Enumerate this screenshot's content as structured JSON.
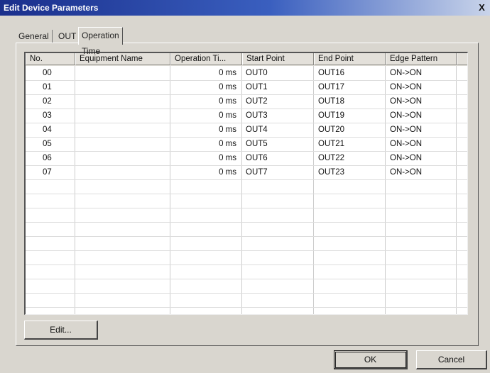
{
  "window": {
    "title": "Edit Device Parameters",
    "close_label": "X"
  },
  "tabs": [
    {
      "label": "General"
    },
    {
      "label": "OUT"
    },
    {
      "label": "Operation Time"
    }
  ],
  "table": {
    "columns": [
      "No.",
      "Equipment Name",
      "Operation Ti...",
      "Start Point",
      "End Point",
      "Edge Pattern"
    ],
    "rows": [
      [
        "00",
        "",
        "0 ms",
        "OUT0",
        "OUT16",
        "ON->ON"
      ],
      [
        "01",
        "",
        "0 ms",
        "OUT1",
        "OUT17",
        "ON->ON"
      ],
      [
        "02",
        "",
        "0 ms",
        "OUT2",
        "OUT18",
        "ON->ON"
      ],
      [
        "03",
        "",
        "0 ms",
        "OUT3",
        "OUT19",
        "ON->ON"
      ],
      [
        "04",
        "",
        "0 ms",
        "OUT4",
        "OUT20",
        "ON->ON"
      ],
      [
        "05",
        "",
        "0 ms",
        "OUT5",
        "OUT21",
        "ON->ON"
      ],
      [
        "06",
        "",
        "0 ms",
        "OUT6",
        "OUT22",
        "ON->ON"
      ],
      [
        "07",
        "",
        "0 ms",
        "OUT7",
        "OUT23",
        "ON->ON"
      ]
    ]
  },
  "buttons": {
    "edit": "Edit...",
    "ok": "OK",
    "cancel": "Cancel"
  }
}
